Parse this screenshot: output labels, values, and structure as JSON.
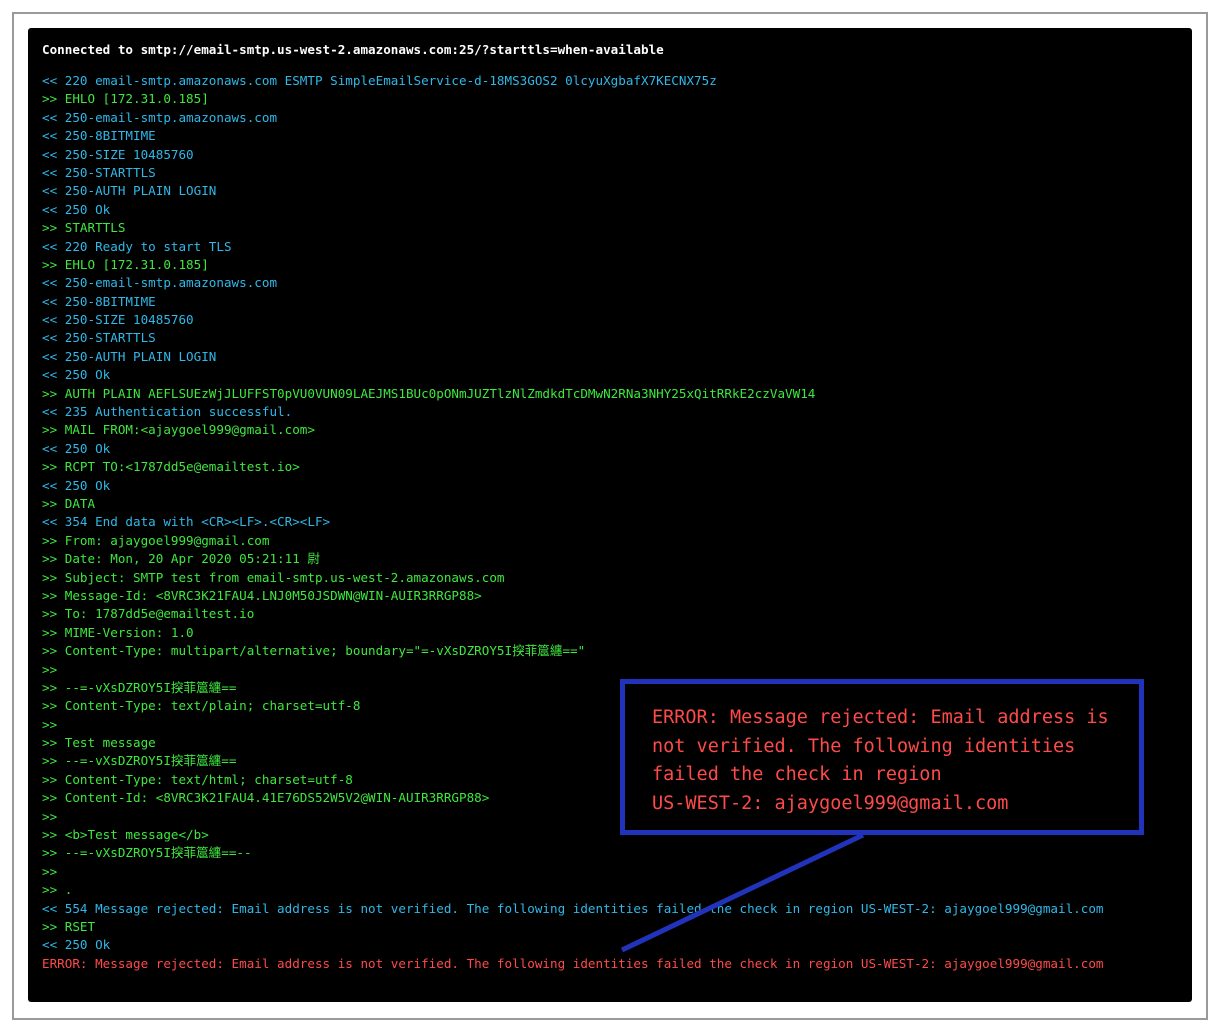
{
  "connection_header": "Connected to smtp://email-smtp.us-west-2.amazonaws.com:25/?starttls=when-available",
  "log_lines": [
    {
      "dir": "in",
      "text": "<< 220 email-smtp.amazonaws.com ESMTP SimpleEmailService-d-18MS3GOS2 0lcyuXgbafX7KECNX75z"
    },
    {
      "dir": "out",
      "text": ">> EHLO [172.31.0.185]"
    },
    {
      "dir": "in",
      "text": "<< 250-email-smtp.amazonaws.com"
    },
    {
      "dir": "in",
      "text": "<< 250-8BITMIME"
    },
    {
      "dir": "in",
      "text": "<< 250-SIZE 10485760"
    },
    {
      "dir": "in",
      "text": "<< 250-STARTTLS"
    },
    {
      "dir": "in",
      "text": "<< 250-AUTH PLAIN LOGIN"
    },
    {
      "dir": "in",
      "text": "<< 250 Ok"
    },
    {
      "dir": "out",
      "text": ">> STARTTLS"
    },
    {
      "dir": "in",
      "text": "<< 220 Ready to start TLS"
    },
    {
      "dir": "out",
      "text": ">> EHLO [172.31.0.185]"
    },
    {
      "dir": "in",
      "text": "<< 250-email-smtp.amazonaws.com"
    },
    {
      "dir": "in",
      "text": "<< 250-8BITMIME"
    },
    {
      "dir": "in",
      "text": "<< 250-SIZE 10485760"
    },
    {
      "dir": "in",
      "text": "<< 250-STARTTLS"
    },
    {
      "dir": "in",
      "text": "<< 250-AUTH PLAIN LOGIN"
    },
    {
      "dir": "in",
      "text": "<< 250 Ok"
    },
    {
      "dir": "out",
      "text": ">> AUTH PLAIN AEFLSUEzWjJLUFFST0pVU0VUN09LAEJMS1BUc0pONmJUZTlzNlZmdkdTcDMwN2RNa3NHY25xQitRRkE2czVaVW14"
    },
    {
      "dir": "in",
      "text": "<< 235 Authentication successful."
    },
    {
      "dir": "out",
      "text": ">> MAIL FROM:<ajaygoel999@gmail.com>"
    },
    {
      "dir": "in",
      "text": "<< 250 Ok"
    },
    {
      "dir": "out",
      "text": ">> RCPT TO:<1787dd5e@emailtest.io>"
    },
    {
      "dir": "in",
      "text": "<< 250 Ok"
    },
    {
      "dir": "out",
      "text": ">> DATA"
    },
    {
      "dir": "in",
      "text": "<< 354 End data with <CR><LF>.<CR><LF>"
    },
    {
      "dir": "out",
      "text": ">> From: ajaygoel999@gmail.com"
    },
    {
      "dir": "out",
      "text": ">> Date: Mon, 20 Apr 2020 05:21:11 尉"
    },
    {
      "dir": "out",
      "text": ">> Subject: SMTP test from email-smtp.us-west-2.amazonaws.com"
    },
    {
      "dir": "out",
      "text": ">> Message-Id: <8VRC3K21FAU4.LNJ0M50JSDWN@WIN-AUIR3RRGP88>"
    },
    {
      "dir": "out",
      "text": ">> To: 1787dd5e@emailtest.io"
    },
    {
      "dir": "out",
      "text": ">> MIME-Version: 1.0"
    },
    {
      "dir": "out",
      "text": ">> Content-Type: multipart/alternative; boundary=\"=-vXsDZROY5I揬菲簄纏==\""
    },
    {
      "dir": "out",
      "text": ">>"
    },
    {
      "dir": "out",
      "text": ">> --=-vXsDZROY5I揬菲簄纏=="
    },
    {
      "dir": "out",
      "text": ">> Content-Type: text/plain; charset=utf-8"
    },
    {
      "dir": "out",
      "text": ">>"
    },
    {
      "dir": "out",
      "text": ">> Test message"
    },
    {
      "dir": "out",
      "text": ">> --=-vXsDZROY5I揬菲簄纏=="
    },
    {
      "dir": "out",
      "text": ">> Content-Type: text/html; charset=utf-8"
    },
    {
      "dir": "out",
      "text": ">> Content-Id: <8VRC3K21FAU4.41E76DS52W5V2@WIN-AUIR3RRGP88>"
    },
    {
      "dir": "out",
      "text": ">>"
    },
    {
      "dir": "out",
      "text": ">> <b>Test message</b>"
    },
    {
      "dir": "out",
      "text": ">> --=-vXsDZROY5I揬菲簄纏==--"
    },
    {
      "dir": "out",
      "text": ">>"
    },
    {
      "dir": "out",
      "text": ">> ."
    },
    {
      "dir": "in",
      "text": "<< 554 Message rejected: Email address is not verified. The following identities failed the check in region US-WEST-2: ajaygoel999@gmail.com"
    },
    {
      "dir": "out",
      "text": ">> RSET"
    },
    {
      "dir": "in",
      "text": "<< 250 Ok"
    },
    {
      "dir": "err",
      "text": "ERROR: Message rejected: Email address is not verified. The following identities failed the check in region US-WEST-2: ajaygoel999@gmail.com"
    }
  ],
  "callout_lines": [
    "ERROR: Message rejected: Email address is",
    "not verified. The following identities",
    "failed the check in region",
    "US-WEST-2: ajaygoel999@gmail.com"
  ],
  "colors": {
    "server_response": "#2fb8e8",
    "client_command": "#3ee83e",
    "error": "#ff4a4a",
    "callout_border": "#2233bb"
  }
}
